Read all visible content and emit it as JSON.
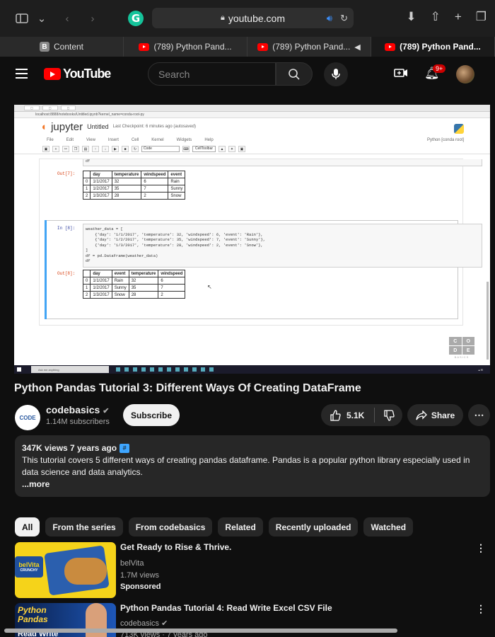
{
  "browser": {
    "url": "youtube.com",
    "tabs": [
      {
        "label": "Content",
        "icon": "b-icon"
      },
      {
        "label": "(789) Python Pand...",
        "icon": "youtube-icon"
      },
      {
        "label": "(789) Python Pand...",
        "icon": "youtube-icon"
      },
      {
        "label": "(789) Python Pand...",
        "icon": "youtube-icon",
        "active": true
      }
    ]
  },
  "youtube": {
    "logo": "YouTube",
    "search_placeholder": "Search",
    "notif_count": "9+"
  },
  "video_frame": {
    "mini_url": "localhost:8888/notebooks/Untitled.ipynb?kernel_name=conda-root-py",
    "jupyter_name": "jupyter",
    "nb_title": "Untitled",
    "checkpoint": "Last Checkpoint: 6 minutes ago (autosaved)",
    "menu": [
      "File",
      "Edit",
      "View",
      "Insert",
      "Cell",
      "Kernel",
      "Widgets",
      "Help"
    ],
    "kernel": "Python [conda root]",
    "cell_type": "Code",
    "celltoolbar": "CellToolbar",
    "out7_label": "Out[7]:",
    "in8_label": "In [8]:",
    "out8_label": "Out[8]:",
    "df_var": "df",
    "code": "weather_data = [\n    {'day': '1/1/2017', 'temperature': 32, 'windspeed': 6, 'event': 'Rain'},\n    {'day': '1/2/2017', 'temperature': 35, 'windspeed': 7, 'event': 'Sunny'},\n    {'day': '1/3/2017', 'temperature': 28, 'windspeed': 2, 'event': 'Snow'},\n]\ndf = pd.DataFrame(weather_data)\ndf",
    "table1": {
      "headers": [
        "",
        "day",
        "temperature",
        "windspeed",
        "event"
      ],
      "rows": [
        [
          "0",
          "1/1/2017",
          "32",
          "6",
          "Rain"
        ],
        [
          "1",
          "1/2/2017",
          "35",
          "7",
          "Sunny"
        ],
        [
          "2",
          "1/3/2017",
          "28",
          "2",
          "Snow"
        ]
      ]
    },
    "table2": {
      "headers": [
        "",
        "day",
        "event",
        "temperature",
        "windspeed"
      ],
      "rows": [
        [
          "0",
          "1/1/2017",
          "Rain",
          "32",
          "6"
        ],
        [
          "1",
          "1/2/2017",
          "Sunny",
          "35",
          "7"
        ],
        [
          "2",
          "1/3/2017",
          "Snow",
          "28",
          "2"
        ]
      ]
    },
    "brand": [
      "C",
      "O",
      "D",
      "E"
    ],
    "brand_sub": "BASICS",
    "taskbar_search": "Ask me anything"
  },
  "video": {
    "title": "Python Pandas Tutorial 3: Different Ways Of Creating DataFrame",
    "channel": "codebasics",
    "channel_logo": "CODE",
    "subscribers": "1.14M subscribers",
    "subscribe_label": "Subscribe",
    "likes": "5.1K",
    "share_label": "Share"
  },
  "description": {
    "stats": "347K views  7 years ago",
    "hashtag": "#",
    "text": "This tutorial covers 5 different ways of creating pandas dataframe. Pandas is a popular python library especially used in data science and data analytics.",
    "more_label": "...more"
  },
  "chips": [
    "All",
    "From the series",
    "From codebasics",
    "Related",
    "Recently uploaded",
    "Watched"
  ],
  "recommendations": [
    {
      "title": "Get Ready to Rise & Thrive.",
      "channel": "belVita",
      "views": "1.7M views",
      "extra": "Sponsored",
      "thumb_brand": "belVita",
      "thumb_sub": "CRUNCHY"
    },
    {
      "title": "Python Pandas Tutorial 4: Read Write Excel CSV File",
      "channel": "codebasics",
      "views": "713K views · 7 years ago",
      "thumb_text": "Python Pandas",
      "thumb_bottom": "Read Write"
    }
  ]
}
